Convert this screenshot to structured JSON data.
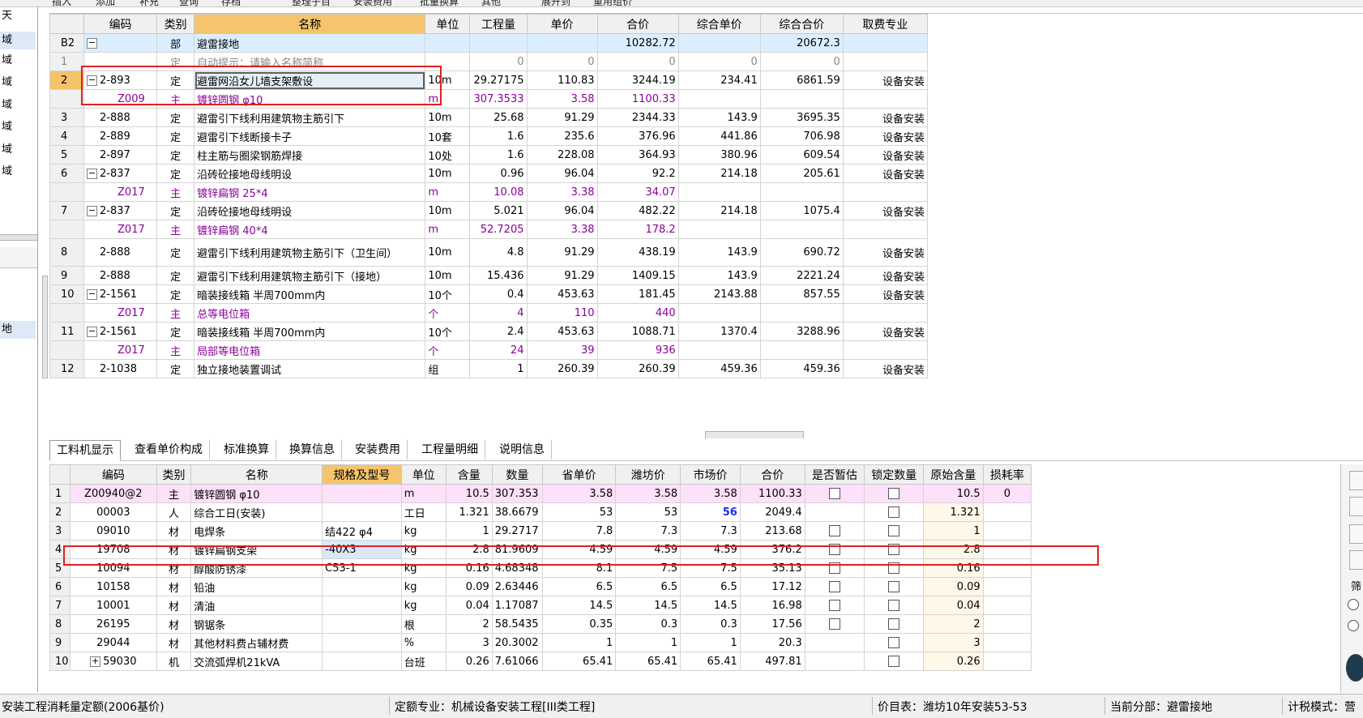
{
  "toolbar": {
    "items": [
      "插入",
      "添加",
      "补充",
      "查询",
      "存档",
      "整理子目",
      "安装费用",
      "批量换算",
      "其他",
      "展开到",
      "重用组价"
    ]
  },
  "left_panel": {
    "items": [
      "天",
      "域",
      "域",
      "域",
      "域",
      "域",
      "域",
      "域"
    ],
    "lower_label": "地"
  },
  "upper_table": {
    "headers": [
      "编码",
      "类别",
      "名称",
      "单位",
      "工程量",
      "单价",
      "合价",
      "综合单价",
      "综合合价",
      "取费专业"
    ],
    "rows": [
      {
        "rn": "B2",
        "code": "",
        "type": "部",
        "name": "避雷接地",
        "unit": "",
        "qty": "",
        "price": "",
        "total": "10282.72",
        "comp_price": "",
        "comp_total": "20672.3",
        "fee": ""
      },
      {
        "rn": "1",
        "code": "",
        "type": "定",
        "name": "自动提示：请输入名称简称",
        "unit": "",
        "qty": "0",
        "price": "0",
        "total": "0",
        "comp_price": "0",
        "comp_total": "0",
        "fee": ""
      },
      {
        "rn": "2",
        "code": "2-893",
        "type": "定",
        "name": "避雷网沿女儿墙支架敷设",
        "unit": "10m",
        "qty": "29.27175",
        "price": "110.83",
        "total": "3244.19",
        "comp_price": "234.41",
        "comp_total": "6861.59",
        "fee": "设备安装"
      },
      {
        "rn": "",
        "code": "Z009",
        "type": "主",
        "name": "镀锌圆钢 φ10",
        "unit": "m",
        "qty": "307.3533",
        "price": "3.58",
        "total": "1100.33",
        "comp_price": "",
        "comp_total": "",
        "fee": ""
      },
      {
        "rn": "3",
        "code": "2-888",
        "type": "定",
        "name": "避雷引下线利用建筑物主筋引下",
        "unit": "10m",
        "qty": "25.68",
        "price": "91.29",
        "total": "2344.33",
        "comp_price": "143.9",
        "comp_total": "3695.35",
        "fee": "设备安装"
      },
      {
        "rn": "4",
        "code": "2-889",
        "type": "定",
        "name": "避雷引下线断接卡子",
        "unit": "10套",
        "qty": "1.6",
        "price": "235.6",
        "total": "376.96",
        "comp_price": "441.86",
        "comp_total": "706.98",
        "fee": "设备安装"
      },
      {
        "rn": "5",
        "code": "2-897",
        "type": "定",
        "name": "柱主筋与圈梁钢筋焊接",
        "unit": "10处",
        "qty": "1.6",
        "price": "228.08",
        "total": "364.93",
        "comp_price": "380.96",
        "comp_total": "609.54",
        "fee": "设备安装"
      },
      {
        "rn": "6",
        "code": "2-837",
        "type": "定",
        "name": "沿砖砼接地母线明设",
        "unit": "10m",
        "qty": "0.96",
        "price": "96.04",
        "total": "92.2",
        "comp_price": "214.18",
        "comp_total": "205.61",
        "fee": "设备安装"
      },
      {
        "rn": "",
        "code": "Z017",
        "type": "主",
        "name": "镀锌扁钢 25*4",
        "unit": "m",
        "qty": "10.08",
        "price": "3.38",
        "total": "34.07",
        "comp_price": "",
        "comp_total": "",
        "fee": ""
      },
      {
        "rn": "7",
        "code": "2-837",
        "type": "定",
        "name": "沿砖砼接地母线明设",
        "unit": "10m",
        "qty": "5.021",
        "price": "96.04",
        "total": "482.22",
        "comp_price": "214.18",
        "comp_total": "1075.4",
        "fee": "设备安装"
      },
      {
        "rn": "",
        "code": "Z017",
        "type": "主",
        "name": "镀锌扁钢 40*4",
        "unit": "m",
        "qty": "52.7205",
        "price": "3.38",
        "total": "178.2",
        "comp_price": "",
        "comp_total": "",
        "fee": ""
      },
      {
        "rn": "8",
        "code": "2-888",
        "type": "定",
        "name": "避雷引下线利用建筑物主筋引下（卫生间）",
        "unit": "10m",
        "qty": "4.8",
        "price": "91.29",
        "total": "438.19",
        "comp_price": "143.9",
        "comp_total": "690.72",
        "fee": "设备安装"
      },
      {
        "rn": "9",
        "code": "2-888",
        "type": "定",
        "name": "避雷引下线利用建筑物主筋引下（接地）",
        "unit": "10m",
        "qty": "15.436",
        "price": "91.29",
        "total": "1409.15",
        "comp_price": "143.9",
        "comp_total": "2221.24",
        "fee": "设备安装"
      },
      {
        "rn": "10",
        "code": "2-1561",
        "type": "定",
        "name": "暗装接线箱 半周700mm内",
        "unit": "10个",
        "qty": "0.4",
        "price": "453.63",
        "total": "181.45",
        "comp_price": "2143.88",
        "comp_total": "857.55",
        "fee": "设备安装"
      },
      {
        "rn": "",
        "code": "Z017",
        "type": "主",
        "name": "总等电位箱",
        "unit": "个",
        "qty": "4",
        "price": "110",
        "total": "440",
        "comp_price": "",
        "comp_total": "",
        "fee": ""
      },
      {
        "rn": "11",
        "code": "2-1561",
        "type": "定",
        "name": "暗装接线箱 半周700mm内",
        "unit": "10个",
        "qty": "2.4",
        "price": "453.63",
        "total": "1088.71",
        "comp_price": "1370.4",
        "comp_total": "3288.96",
        "fee": "设备安装"
      },
      {
        "rn": "",
        "code": "Z017",
        "type": "主",
        "name": "局部等电位箱",
        "unit": "个",
        "qty": "24",
        "price": "39",
        "total": "936",
        "comp_price": "",
        "comp_total": "",
        "fee": ""
      },
      {
        "rn": "12",
        "code": "2-1038",
        "type": "定",
        "name": "独立接地装置调试",
        "unit": "组",
        "qty": "1",
        "price": "260.39",
        "total": "260.39",
        "comp_price": "459.36",
        "comp_total": "459.36",
        "fee": "设备安装"
      }
    ]
  },
  "tabs": [
    "工料机显示",
    "查看单价构成",
    "标准换算",
    "换算信息",
    "安装费用",
    "工程量明细",
    "说明信息"
  ],
  "lower_table": {
    "headers": [
      "编码",
      "类别",
      "名称",
      "规格及型号",
      "单位",
      "含量",
      "数量",
      "省单价",
      "潍坊价",
      "市场价",
      "合价",
      "是否暂估",
      "锁定数量",
      "原始含量",
      "损耗率"
    ],
    "rows": [
      {
        "rn": "1",
        "code": "Z00940@2",
        "type": "主",
        "name": "镀锌圆钢 φ10",
        "spec": "",
        "unit": "m",
        "content": "10.5",
        "qty": "307.353",
        "prov": "3.58",
        "wf": "3.58",
        "market": "3.58",
        "total": "1100.33",
        "orig": "10.5",
        "loss": "0"
      },
      {
        "rn": "2",
        "code": "00003",
        "type": "人",
        "name": "综合工日(安装)",
        "spec": "",
        "unit": "工日",
        "content": "1.321",
        "qty": "38.6679",
        "prov": "53",
        "wf": "53",
        "market": "56",
        "total": "2049.4",
        "orig": "1.321",
        "loss": ""
      },
      {
        "rn": "3",
        "code": "09010",
        "type": "材",
        "name": "电焊条",
        "spec": "结422 φ4",
        "unit": "kg",
        "content": "1",
        "qty": "29.2717",
        "prov": "7.8",
        "wf": "7.3",
        "market": "7.3",
        "total": "213.68",
        "orig": "1",
        "loss": ""
      },
      {
        "rn": "4",
        "code": "19708",
        "type": "材",
        "name": "镀锌扁钢支架",
        "spec": "-40X3",
        "unit": "kg",
        "content": "2.8",
        "qty": "81.9609",
        "prov": "4.59",
        "wf": "4.59",
        "market": "4.59",
        "total": "376.2",
        "orig": "2.8",
        "loss": ""
      },
      {
        "rn": "5",
        "code": "10094",
        "type": "材",
        "name": "醇酸防锈漆",
        "spec": "C53-1",
        "unit": "kg",
        "content": "0.16",
        "qty": "4.68348",
        "prov": "8.1",
        "wf": "7.5",
        "market": "7.5",
        "total": "35.13",
        "orig": "0.16",
        "loss": ""
      },
      {
        "rn": "6",
        "code": "10158",
        "type": "材",
        "name": "铅油",
        "spec": "",
        "unit": "kg",
        "content": "0.09",
        "qty": "2.63446",
        "prov": "6.5",
        "wf": "6.5",
        "market": "6.5",
        "total": "17.12",
        "orig": "0.09",
        "loss": ""
      },
      {
        "rn": "7",
        "code": "10001",
        "type": "材",
        "name": "清油",
        "spec": "",
        "unit": "kg",
        "content": "0.04",
        "qty": "1.17087",
        "prov": "14.5",
        "wf": "14.5",
        "market": "14.5",
        "total": "16.98",
        "orig": "0.04",
        "loss": ""
      },
      {
        "rn": "8",
        "code": "26195",
        "type": "材",
        "name": "钢锯条",
        "spec": "",
        "unit": "根",
        "content": "2",
        "qty": "58.5435",
        "prov": "0.35",
        "wf": "0.3",
        "market": "0.3",
        "total": "17.56",
        "orig": "2",
        "loss": ""
      },
      {
        "rn": "9",
        "code": "29044",
        "type": "材",
        "name": "其他材料费占辅材费",
        "spec": "",
        "unit": "%",
        "content": "3",
        "qty": "20.3002",
        "prov": "1",
        "wf": "1",
        "market": "1",
        "total": "20.3",
        "orig": "3",
        "loss": ""
      },
      {
        "rn": "10",
        "code": "59030",
        "type": "机",
        "name": "交流弧焊机21kVA",
        "spec": "",
        "unit": "台班",
        "content": "0.26",
        "qty": "7.61066",
        "prov": "65.41",
        "wf": "65.41",
        "market": "65.41",
        "total": "497.81",
        "orig": "0.26",
        "loss": ""
      }
    ]
  },
  "right_strip": {
    "label": "筛"
  },
  "status": {
    "s1": "安装工程消耗量定额(2006基价)",
    "s2": "定额专业：机械设备安装工程[III类工程]",
    "s3": "价目表：潍坊10年安装53-53",
    "s4": "当前分部：避雷接地",
    "s5": "计税模式：营"
  },
  "colors": {
    "header_orange": "#f5c46c",
    "main_material": "#8b009b",
    "highlight_box": "#e02020",
    "selected_row": "#dbeeff"
  }
}
